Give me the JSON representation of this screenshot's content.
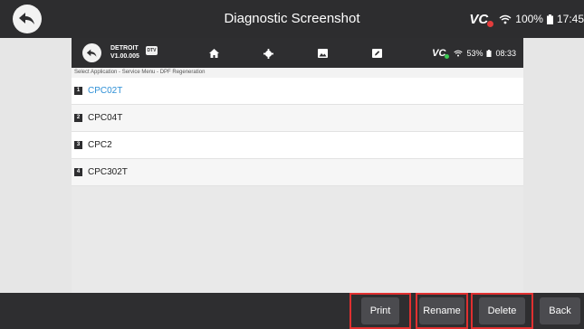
{
  "header": {
    "title": "Diagnostic Screenshot",
    "brand": "VC",
    "battery": "100%",
    "time": "17:45"
  },
  "inner": {
    "app_name": "DETROIT",
    "version": "V1.00.005",
    "app_badge": "DTV",
    "brand": "VC",
    "battery": "53%",
    "time": "08:33",
    "breadcrumb": "Select Application - Service Menu - DPF Regeneration",
    "items": [
      {
        "num": "1",
        "label": "CPC02T"
      },
      {
        "num": "2",
        "label": "CPC04T"
      },
      {
        "num": "3",
        "label": "CPC2"
      },
      {
        "num": "4",
        "label": "CPC302T"
      }
    ]
  },
  "footer": {
    "print": "Print",
    "rename": "Rename",
    "delete": "Delete",
    "back": "Back"
  },
  "colors": {
    "selected": "#2d8fd6",
    "highlight_box": "#e03030"
  }
}
